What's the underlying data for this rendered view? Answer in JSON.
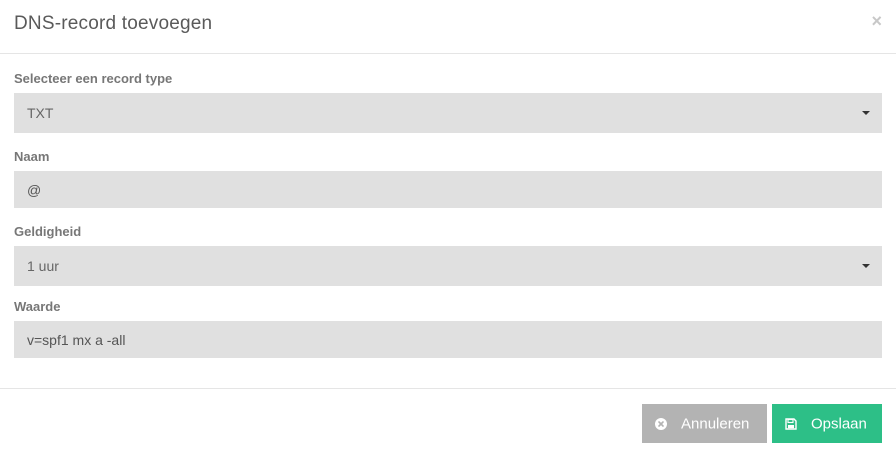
{
  "header": {
    "title": "DNS-record toevoegen",
    "close_glyph": "×"
  },
  "form": {
    "record_type": {
      "label": "Selecteer een record type",
      "value": "TXT"
    },
    "name": {
      "label": "Naam",
      "value": "@"
    },
    "ttl": {
      "label": "Geldigheid",
      "value": "1 uur"
    },
    "value": {
      "label": "Waarde",
      "value": "v=spf1 mx a -all"
    }
  },
  "footer": {
    "cancel_label": "Annuleren",
    "cancel_icon": "times-circle-icon",
    "save_label": "Opslaan",
    "save_icon": "floppy-disk-icon"
  },
  "colors": {
    "save_button": "#2dbf87",
    "cancel_button": "#b3b3b3",
    "field_background": "#e0e0e0"
  }
}
